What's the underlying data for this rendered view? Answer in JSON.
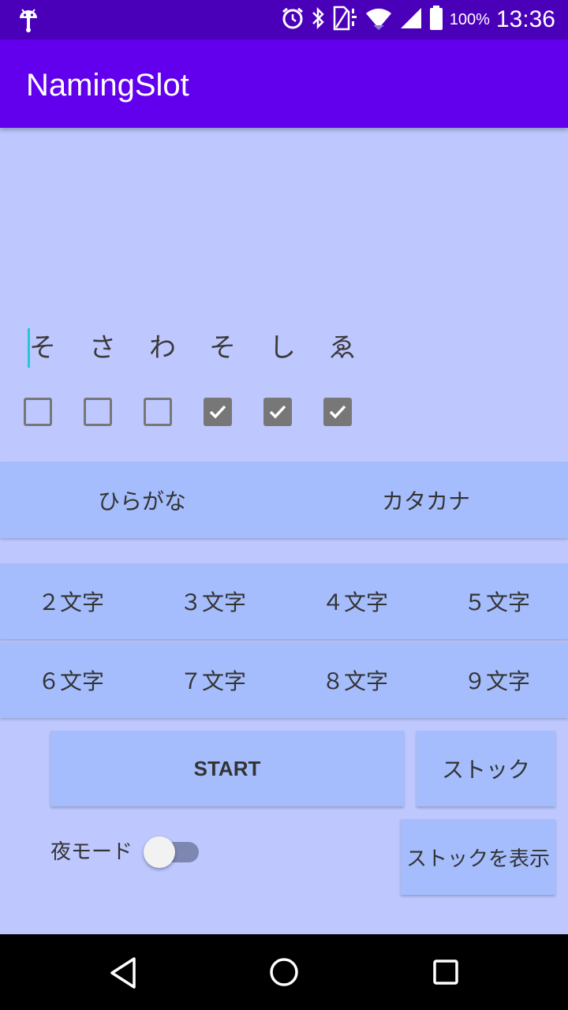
{
  "status_bar": {
    "battery_text": "100%",
    "time": "13:36",
    "icons": [
      "android-icon",
      "alarm-icon",
      "bluetooth-icon",
      "no-sim-icon",
      "wifi-icon",
      "signal-icon",
      "battery-icon"
    ]
  },
  "app": {
    "title": "NamingSlot"
  },
  "slots": [
    "そ",
    "さ",
    "わ",
    "そ",
    "し",
    "ゑ"
  ],
  "locks": [
    false,
    false,
    false,
    true,
    true,
    true
  ],
  "script_buttons": [
    "ひらがな",
    "カタカナ"
  ],
  "length_buttons": {
    "row1": [
      "２文字",
      "３文字",
      "４文字",
      "５文字"
    ],
    "row2": [
      "６文字",
      "７文字",
      "８文字",
      "９文字"
    ]
  },
  "actions": {
    "start": "START",
    "stock": "ストック",
    "show_stock": "ストックを表示"
  },
  "night_mode": {
    "label": "夜モード",
    "on": false
  },
  "colors": {
    "status_bar": "#4A00B8",
    "app_bar": "#6200EE",
    "background": "#BEC8FE",
    "button": "#A5BDFC",
    "cursor": "#26C6DA"
  }
}
